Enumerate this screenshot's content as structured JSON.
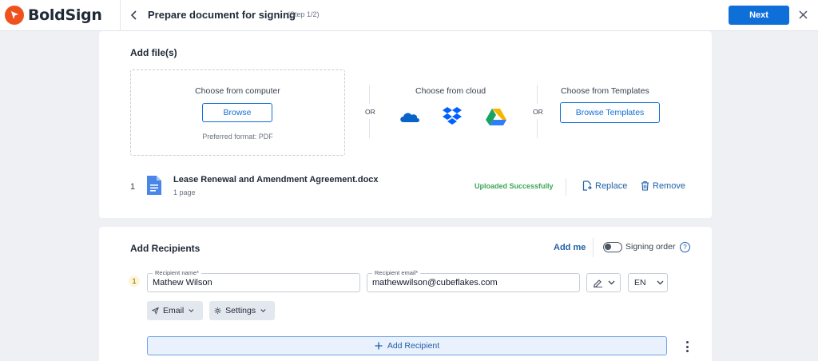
{
  "header": {
    "brand": "BoldSign",
    "title": "Prepare document for signing",
    "step": "(Step 1/2)",
    "next_label": "Next"
  },
  "files": {
    "section_title": "Add file(s)",
    "computer": {
      "title": "Choose from computer",
      "browse_label": "Browse",
      "hint": "Preferred format: PDF"
    },
    "or_left": "OR",
    "or_right": "OR",
    "cloud": {
      "title": "Choose from cloud",
      "providers": [
        "onedrive-icon",
        "dropbox-icon",
        "google-drive-icon"
      ]
    },
    "templates": {
      "title": "Choose from Templates",
      "button_label": "Browse Templates"
    },
    "uploaded": [
      {
        "index": "1",
        "name": "Lease Renewal and Amendment Agreement.docx",
        "pages": "1 page",
        "status": "Uploaded Successfully",
        "replace_label": "Replace",
        "remove_label": "Remove"
      }
    ]
  },
  "recipients": {
    "section_title": "Add Recipients",
    "add_me_label": "Add me",
    "signing_order_label": "Signing order",
    "signing_order_enabled": false,
    "help": "?",
    "list": [
      {
        "index": "1",
        "name_label": "Recipient name*",
        "name": "Mathew Wilson",
        "email_label": "Recipient email*",
        "email": "mathewwilson@cubeflakes.com",
        "language": "EN",
        "delivery": "Email",
        "settings_label": "Settings"
      }
    ],
    "add_recipient_label": "Add Recipient"
  },
  "colors": {
    "brand": "#f0521e",
    "primary": "#0f6fd9",
    "link": "#1f5fa8",
    "success": "#3aa655"
  }
}
